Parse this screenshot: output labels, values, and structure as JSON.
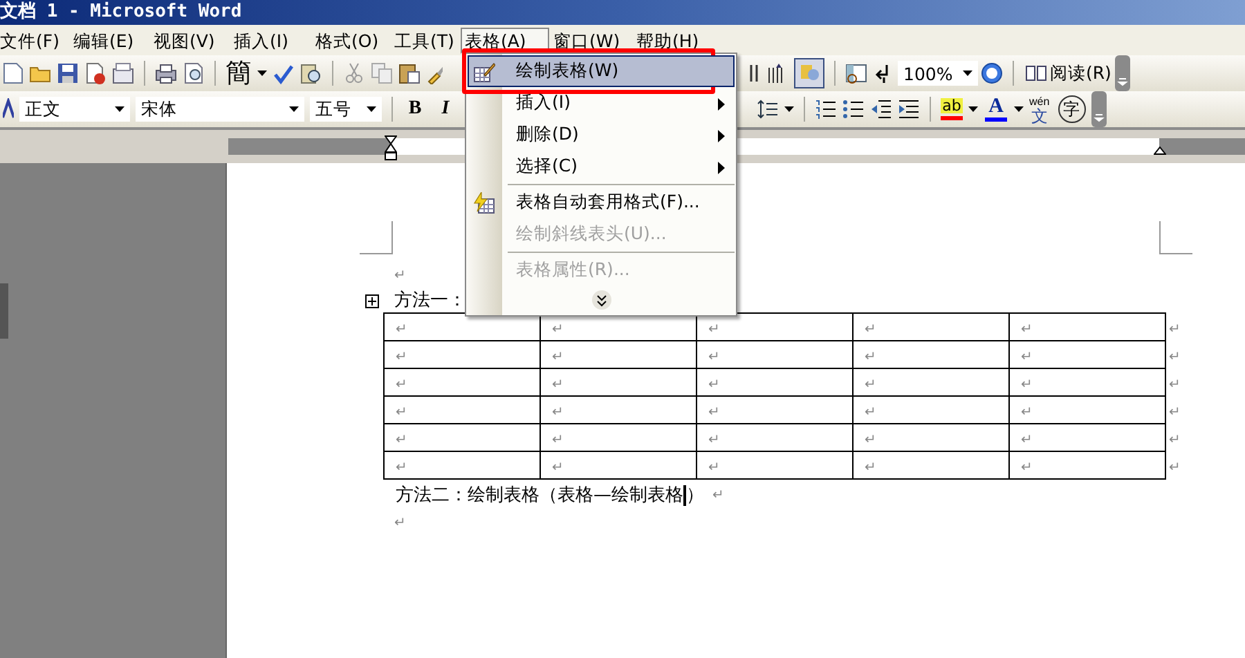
{
  "window": {
    "title": "文档 1 - Microsoft Word"
  },
  "menu_bar": [
    {
      "label": "文件(F)",
      "selected": false
    },
    {
      "label": "编辑(E)",
      "selected": false
    },
    {
      "label": "视图(V)",
      "selected": false
    },
    {
      "label": "插入(I)",
      "selected": false
    },
    {
      "label": "格式(O)",
      "selected": false
    },
    {
      "label": "工具(T)",
      "selected": false
    },
    {
      "label": "表格(A)",
      "selected": true
    },
    {
      "label": "窗口(W)",
      "selected": false
    },
    {
      "label": "帮助(H)",
      "selected": false
    }
  ],
  "standard_toolbar": {
    "convert_button": "簡",
    "zoom": "100%",
    "read_button": "阅读(R)"
  },
  "formatting_toolbar": {
    "style": "正文",
    "font": "宋体",
    "size": "五号",
    "bold": "B",
    "italic": "I",
    "highlight": "ab",
    "font_color": "A",
    "phonetic_top": "wén",
    "phonetic_bottom": "文",
    "enclose": "字"
  },
  "table_menu": [
    {
      "kind": "command",
      "label": "绘制表格(W)",
      "selected": true,
      "disabled": false
    },
    {
      "kind": "submenu",
      "label": "插入(I)",
      "selected": false,
      "disabled": false
    },
    {
      "kind": "submenu",
      "label": "删除(D)",
      "selected": false,
      "disabled": false
    },
    {
      "kind": "submenu",
      "label": "选择(C)",
      "selected": false,
      "disabled": false
    },
    {
      "kind": "separator"
    },
    {
      "kind": "command",
      "label": "表格自动套用格式(F)...",
      "selected": false,
      "disabled": false
    },
    {
      "kind": "command",
      "label": "绘制斜线表头(U)...",
      "selected": false,
      "disabled": true
    },
    {
      "kind": "separator"
    },
    {
      "kind": "command",
      "label": "表格属性(R)...",
      "selected": false,
      "disabled": true
    },
    {
      "kind": "expand"
    }
  ],
  "annotation": {
    "kind": "frame"
  },
  "document": {
    "blank_line_1": "↵",
    "method_one": "方法一：",
    "table": {
      "rows": [
        [
          "↵",
          "↵",
          "↵",
          "↵",
          "↵"
        ],
        [
          "↵",
          "↵",
          "↵",
          "↵",
          "↵"
        ],
        [
          "↵",
          "↵",
          "↵",
          "↵",
          "↵"
        ],
        [
          "↵",
          "↵",
          "↵",
          "↵",
          "↵"
        ],
        [
          "↵",
          "↵",
          "↵",
          "↵",
          "↵"
        ],
        [
          "↵",
          "↵",
          "↵",
          "↵",
          "↵"
        ]
      ],
      "row_end_marks": [
        "↵",
        "↵",
        "↵",
        "↵",
        "↵",
        "↵"
      ]
    },
    "method_two": "方法二：绘制表格（表格—绘制表格",
    "method_two_end": "）",
    "method_two_mark": "↵",
    "blank_line_2": "↵"
  }
}
